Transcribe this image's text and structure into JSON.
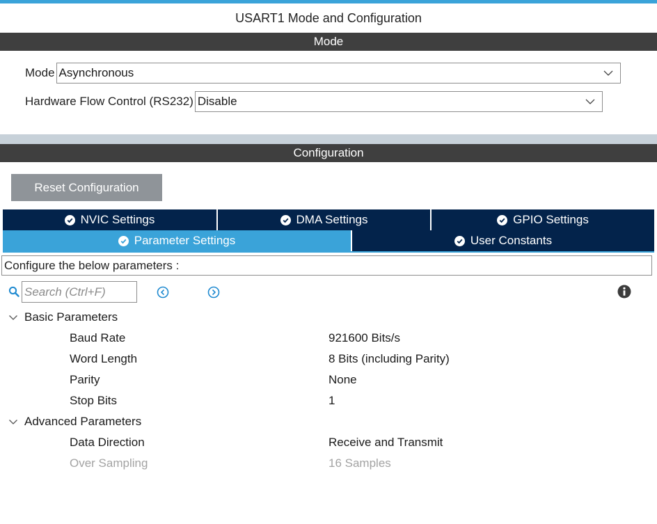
{
  "panel": {
    "title": "USART1 Mode and Configuration"
  },
  "mode_section": {
    "header": "Mode",
    "mode": {
      "label": "Mode",
      "value": "Asynchronous"
    },
    "flow_control": {
      "label": "Hardware Flow Control (RS232)",
      "value": "Disable"
    }
  },
  "config_section": {
    "header": "Configuration",
    "reset_label": "Reset Configuration",
    "tabs": {
      "nvic": "NVIC Settings",
      "dma": "DMA Settings",
      "gpio": "GPIO Settings",
      "parameter": "Parameter Settings",
      "user_constants": "User Constants"
    },
    "active_tab": "parameter",
    "hint": "Configure the below parameters :",
    "search": {
      "placeholder": "Search (Ctrl+F)",
      "value": ""
    },
    "icons": {
      "search": "search-icon",
      "prev": "circle-chevron-left-icon",
      "next": "circle-chevron-right-icon",
      "info": "info-icon",
      "tab_check": "check-circle-icon",
      "expand": "chevron-down-icon"
    },
    "groups": [
      {
        "name": "Basic Parameters",
        "params": [
          {
            "name": "Baud Rate",
            "value": "921600 Bits/s",
            "enabled": true
          },
          {
            "name": "Word Length",
            "value": "8 Bits (including Parity)",
            "enabled": true
          },
          {
            "name": "Parity",
            "value": "None",
            "enabled": true
          },
          {
            "name": "Stop Bits",
            "value": "1",
            "enabled": true
          }
        ]
      },
      {
        "name": "Advanced Parameters",
        "params": [
          {
            "name": "Data Direction",
            "value": "Receive and Transmit",
            "enabled": true
          },
          {
            "name": "Over Sampling",
            "value": "16 Samples",
            "enabled": false
          }
        ]
      }
    ]
  },
  "colors": {
    "accent": "#3aa3d9",
    "tab_dark": "#03234b",
    "section_bar": "#3f3f3f",
    "button_gray": "#8f9499",
    "disabled_text": "#a3a3a3"
  }
}
